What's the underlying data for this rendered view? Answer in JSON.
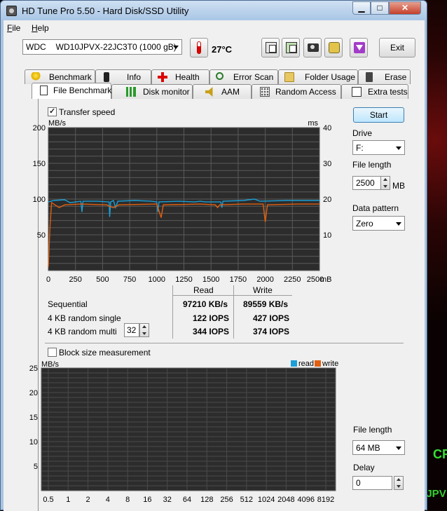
{
  "window": {
    "title": "HD Tune Pro 5.50 - Hard Disk/SSD Utility"
  },
  "menu": {
    "file": "File",
    "help": "Help"
  },
  "toolbar": {
    "drive_model": "WDC",
    "drive_name": "WD10JPVX-22JC3T0 (1000 gB)",
    "temperature": "27°C",
    "exit_label": "Exit"
  },
  "tabs_row1": [
    {
      "label": "Benchmark",
      "icon": "bulb-icon"
    },
    {
      "label": "Info",
      "icon": "info-icon"
    },
    {
      "label": "Health",
      "icon": "health-icon"
    },
    {
      "label": "Error Scan",
      "icon": "magnifier-icon"
    },
    {
      "label": "Folder Usage",
      "icon": "folder-icon"
    },
    {
      "label": "Erase",
      "icon": "trash-icon"
    }
  ],
  "tabs_row2": [
    {
      "label": "File Benchmark",
      "icon": "file-icon",
      "active": true
    },
    {
      "label": "Disk monitor",
      "icon": "bar-chart-icon"
    },
    {
      "label": "AAM",
      "icon": "speaker-icon"
    },
    {
      "label": "Random Access",
      "icon": "dots-icon"
    },
    {
      "label": "Extra tests",
      "icon": "extra-icon"
    }
  ],
  "benchmark": {
    "transfer_speed_label": "Transfer speed",
    "transfer_speed_checked": true,
    "start_label": "Start",
    "drive_label": "Drive",
    "drive_value": "F:",
    "file_length_label": "File length",
    "file_length_value": "2500",
    "file_length_unit": "MB",
    "data_pattern_label": "Data pattern",
    "data_pattern_value": "Zero",
    "results": {
      "read_header": "Read",
      "write_header": "Write",
      "rows": [
        {
          "label": "Sequential",
          "read": "97210 KB/s",
          "write": "89559 KB/s"
        },
        {
          "label": "4 KB random single",
          "read": "122 IOPS",
          "write": "427 IOPS"
        },
        {
          "label": "4 KB random multi",
          "read": "344 IOPS",
          "write": "374 IOPS"
        }
      ],
      "queue_depth": "32"
    }
  },
  "block": {
    "checkbox_label": "Block size measurement",
    "checked": false,
    "file_length_label": "File length",
    "file_length_value": "64 MB",
    "delay_label": "Delay",
    "delay_value": "0"
  },
  "colors": {
    "read": "#1a9fd6",
    "write": "#e06010",
    "grid": "#5a5a5a",
    "chart_bg": "#2c2c2c"
  },
  "chart_data": [
    {
      "type": "line",
      "y_unit_left": "MB/s",
      "y_unit_right": "ms",
      "x_unit": "mB",
      "xlim": [
        0,
        2500
      ],
      "ylim": [
        0,
        200
      ],
      "y2lim": [
        0,
        40
      ],
      "x_ticks": [
        0,
        250,
        500,
        750,
        1000,
        1250,
        1500,
        1750,
        2000,
        2250,
        2500
      ],
      "y_ticks": [
        50,
        100,
        150,
        200
      ],
      "y2_ticks": [
        10,
        20,
        30,
        40
      ],
      "grid": true,
      "series": [
        {
          "name": "read",
          "color": "#1a9fd6",
          "points": [
            [
              0,
              96
            ],
            [
              50,
              98
            ],
            [
              150,
              99
            ],
            [
              200,
              95
            ],
            [
              300,
              97
            ],
            [
              310,
              82
            ],
            [
              320,
              97
            ],
            [
              450,
              97
            ],
            [
              560,
              96
            ],
            [
              565,
              75
            ],
            [
              575,
              96
            ],
            [
              600,
              98
            ],
            [
              620,
              88
            ],
            [
              640,
              97
            ],
            [
              800,
              98
            ],
            [
              950,
              97
            ],
            [
              1000,
              96
            ],
            [
              1010,
              82
            ],
            [
              1020,
              96
            ],
            [
              1200,
              97
            ],
            [
              1350,
              96
            ],
            [
              1400,
              97
            ],
            [
              1450,
              96
            ],
            [
              1590,
              96
            ],
            [
              1600,
              88
            ],
            [
              1610,
              97
            ],
            [
              1800,
              98
            ],
            [
              1900,
              100
            ],
            [
              1950,
              97
            ],
            [
              2200,
              98
            ],
            [
              2500,
              98
            ]
          ]
        },
        {
          "name": "write",
          "color": "#e06010",
          "points": [
            [
              0,
              5
            ],
            [
              15,
              60
            ],
            [
              30,
              95
            ],
            [
              60,
              92
            ],
            [
              100,
              88
            ],
            [
              150,
              92
            ],
            [
              300,
              93
            ],
            [
              540,
              92
            ],
            [
              560,
              90
            ],
            [
              600,
              88
            ],
            [
              650,
              92
            ],
            [
              1000,
              93
            ],
            [
              1040,
              74
            ],
            [
              1060,
              92
            ],
            [
              1400,
              93
            ],
            [
              1540,
              92
            ],
            [
              1560,
              88
            ],
            [
              1580,
              92
            ],
            [
              1800,
              93
            ],
            [
              1980,
              93
            ],
            [
              2000,
              68
            ],
            [
              2020,
              92
            ],
            [
              2300,
              93
            ],
            [
              2500,
              93
            ]
          ]
        }
      ]
    },
    {
      "type": "bar",
      "y_unit": "MB/s",
      "ylim": [
        0,
        25
      ],
      "y_ticks": [
        5,
        10,
        15,
        20,
        25
      ],
      "categories": [
        "0.5",
        "1",
        "2",
        "4",
        "8",
        "16",
        "32",
        "64",
        "128",
        "256",
        "512",
        "1024",
        "2048",
        "4096",
        "8192"
      ],
      "legend": [
        "read",
        "write"
      ],
      "legend_position": "top-right",
      "grid": true,
      "series": []
    }
  ]
}
